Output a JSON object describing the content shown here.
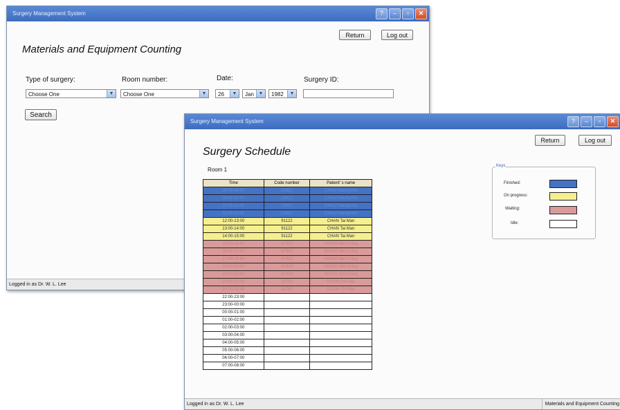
{
  "window1": {
    "title": "Surgery Management System",
    "return_label": "Return",
    "logout_label": "Log out",
    "heading": "Materials and Equipment Counting",
    "fields": {
      "surgery_type_label": "Type of surgery:",
      "surgery_type_value": "Choose One",
      "room_label": "Room number:",
      "room_value": "Choose One",
      "date_label": "Date:",
      "day_value": "26",
      "month_value": "Jan",
      "year_value": "1982",
      "surgery_id_label": "Surgery ID:",
      "surgery_id_value": ""
    },
    "search_label": "Search",
    "status": "Logged in as Dr. W. L. Lee"
  },
  "window2": {
    "title": "Surgery Management System",
    "return_label": "Return",
    "logout_label": "Log out",
    "heading": "Surgery Schedule",
    "room_label": "Room 1",
    "columns": [
      "Time",
      "Code number",
      "Patient' s name"
    ],
    "rows": [
      {
        "time": "08:00-09:00",
        "code": "22621",
        "name": "CHAU Kwong Kei",
        "status": "finished"
      },
      {
        "time": "09:00-10:00",
        "code": "22621",
        "name": "CHAU Kwong Kei",
        "status": "finished"
      },
      {
        "time": "10:00-11:00",
        "code": "22621",
        "name": "CHAU Kwong Kei",
        "status": "finished"
      },
      {
        "time": "11:00-12:00",
        "code": "22621",
        "name": "CHAU Kwong Kei",
        "status": "finished"
      },
      {
        "time": "12:00-13:00",
        "code": "91122",
        "name": "CHAN Tai Man",
        "status": "progress"
      },
      {
        "time": "13:00-14:00",
        "code": "91122",
        "name": "CHAN Tai Man",
        "status": "progress"
      },
      {
        "time": "14:00-15:00",
        "code": "91122",
        "name": "CHAN Tai Man",
        "status": "progress"
      },
      {
        "time": "15:00-16:00",
        "code": "47320",
        "name": "WONG Mei Ching",
        "status": "waiting"
      },
      {
        "time": "16:00-17:00",
        "code": "47320",
        "name": "WONG Mei Ching",
        "status": "waiting"
      },
      {
        "time": "17:00-18:00",
        "code": "47320",
        "name": "WONG Mei Ching",
        "status": "waiting"
      },
      {
        "time": "18:00-19:00",
        "code": "47320",
        "name": "WONG Mei Ching",
        "status": "waiting"
      },
      {
        "time": "19:00-20:00",
        "code": "47320",
        "name": "WONG Mei Ching",
        "status": "waiting"
      },
      {
        "time": "20:00-21:00",
        "code": "31790",
        "name": "POON Chi Wai",
        "status": "waiting"
      },
      {
        "time": "21:00-22:00",
        "code": "31790",
        "name": "POON Chi Wai",
        "status": "waiting"
      },
      {
        "time": "22:00-23:00",
        "code": "",
        "name": "",
        "status": "idle"
      },
      {
        "time": "23:00-00:00",
        "code": "",
        "name": "",
        "status": "idle"
      },
      {
        "time": "00:00-01:00",
        "code": "",
        "name": "",
        "status": "idle"
      },
      {
        "time": "01:00-02:00",
        "code": "",
        "name": "",
        "status": "idle"
      },
      {
        "time": "02:00-03:00",
        "code": "",
        "name": "",
        "status": "idle"
      },
      {
        "time": "03:00-04:00",
        "code": "",
        "name": "",
        "status": "idle"
      },
      {
        "time": "04:00-05:00",
        "code": "",
        "name": "",
        "status": "idle"
      },
      {
        "time": "05:00-06:00",
        "code": "",
        "name": "",
        "status": "idle"
      },
      {
        "time": "06:00-07:00",
        "code": "",
        "name": "",
        "status": "idle"
      },
      {
        "time": "07:00-08:00",
        "code": "",
        "name": "",
        "status": "idle"
      }
    ],
    "keys": {
      "title": "Keys",
      "items": [
        {
          "label": "Finished:",
          "color": "#4472c4"
        },
        {
          "label": "On progress:",
          "color": "#f5ef8e"
        },
        {
          "label": "Waiting:",
          "color": "#d99a9a"
        },
        {
          "label": "Idle:",
          "color": "#ffffff"
        }
      ]
    },
    "status_left": "Logged in as Dr. W. L. Lee",
    "status_right": "Materials and Equipment Counting"
  }
}
